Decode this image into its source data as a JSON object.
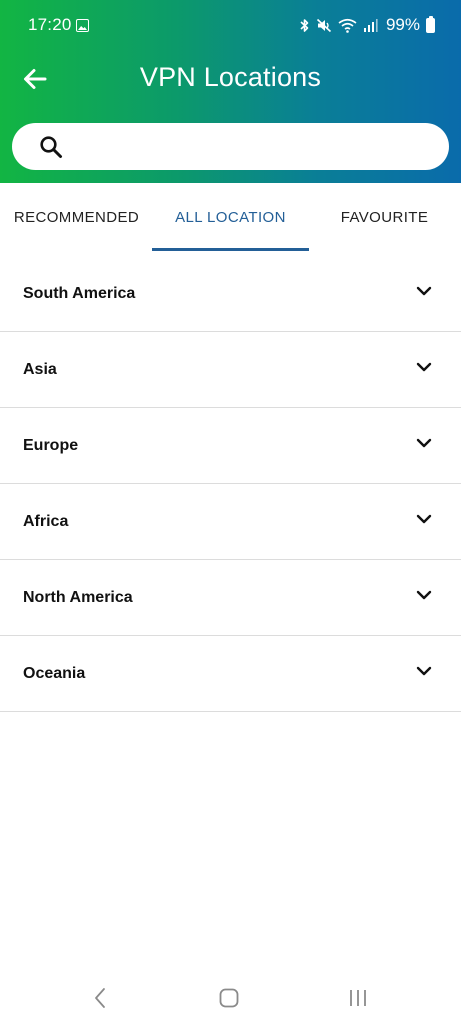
{
  "status_bar": {
    "time": "17:20",
    "battery": "99%"
  },
  "header": {
    "title": "VPN Locations",
    "back_icon": "arrow-left-icon"
  },
  "search": {
    "placeholder": "",
    "value": "",
    "icon": "search-icon"
  },
  "tabs": [
    {
      "label": "RECOMMENDED"
    },
    {
      "label": "ALL LOCATION"
    },
    {
      "label": "FAVOURITE"
    }
  ],
  "active_tab": "ALL LOCATION",
  "regions": [
    {
      "name": "South America"
    },
    {
      "name": "Asia"
    },
    {
      "name": "Europe"
    },
    {
      "name": "Africa"
    },
    {
      "name": "North America"
    },
    {
      "name": "Oceania"
    }
  ],
  "colors": {
    "header_gradient_start": "#12b543",
    "header_gradient_end": "#0a6bab",
    "accent": "#235f97",
    "divider": "#dcdcdc"
  }
}
